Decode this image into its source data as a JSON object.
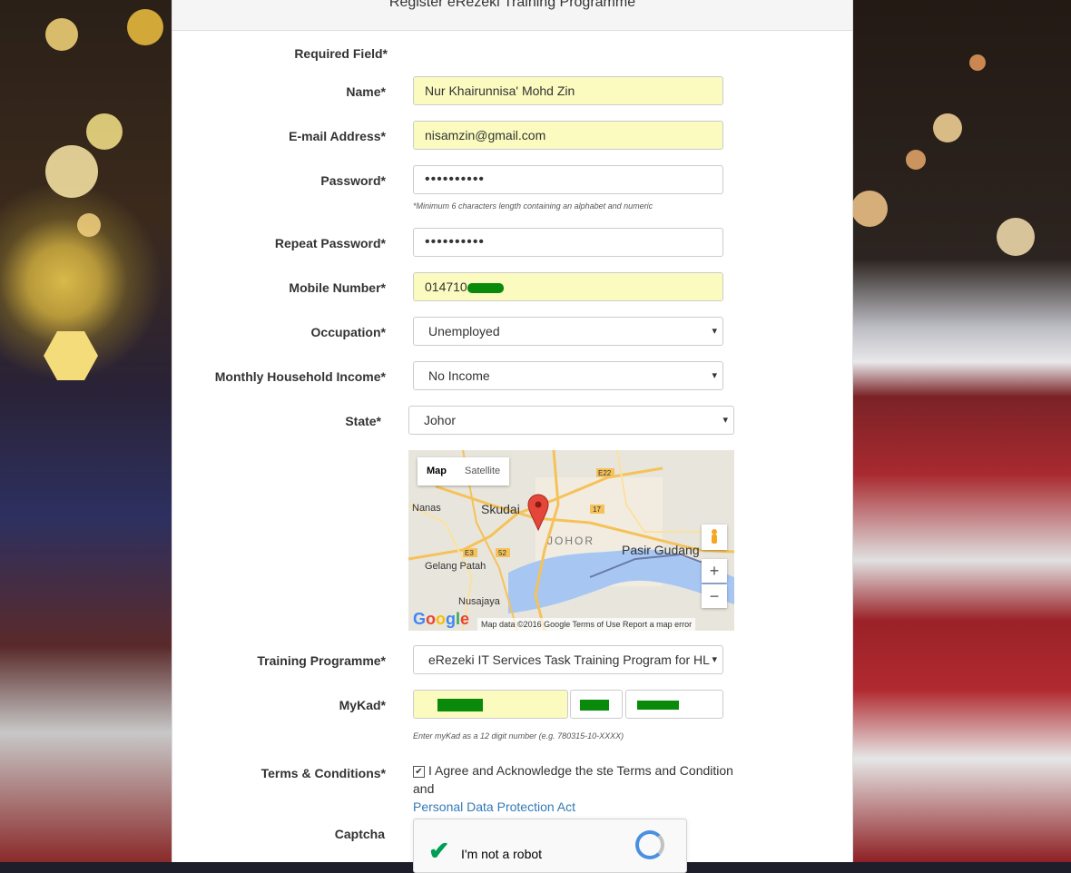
{
  "form": {
    "title": "Register eRezeki Training Programme",
    "required_note": "Required Field*",
    "name": {
      "label": "Name*",
      "value": "Nur Khairunnisa' Mohd Zin"
    },
    "email": {
      "label": "E-mail Address*",
      "value": "nisamzin@gmail.com"
    },
    "password": {
      "label": "Password*",
      "value": "••••••••••",
      "hint": "*Minimum 6 characters length containing an alphabet and numeric"
    },
    "repeat_password": {
      "label": "Repeat Password*",
      "value": "••••••••••"
    },
    "mobile": {
      "label": "Mobile Number*",
      "value": "014710"
    },
    "occupation": {
      "label": "Occupation*",
      "value": "Unemployed"
    },
    "income": {
      "label": "Monthly Household Income*",
      "value": "No Income"
    },
    "state": {
      "label": "State*",
      "value": "Johor"
    },
    "training": {
      "label": "Training Programme*",
      "value": "eRezeki IT Services Task Training Program for HL"
    },
    "mykad": {
      "label": "MyKad*",
      "hint": "Enter myKad as a 12 digit number (e.g. 780315-10-XXXX)"
    },
    "terms": {
      "label": "Terms & Conditions*",
      "text": "I Agree and Acknowledge the ste Terms and Condition and",
      "link": "Personal Data Protection Act",
      "checked": true
    },
    "captcha": {
      "label": "Captcha",
      "text": "I'm not a robot"
    }
  },
  "map": {
    "type_map": "Map",
    "type_satellite": "Satellite",
    "places": {
      "skudai": "Skudai",
      "johor": "JOHOR",
      "pasir_gudang": "Pasir Gudang",
      "nanas": "Nanas",
      "gelang_patah": "Gelang Patah",
      "nusajaya": "Nusajaya"
    },
    "roads": {
      "e22": "E22",
      "r17": "17",
      "e3": "E3",
      "r52": "52"
    },
    "zoom_in": "+",
    "zoom_out": "−",
    "attribution": "Map data ©2016 Google   Terms of Use   Report a map error",
    "logo": "Google"
  },
  "colors": {
    "filled_field": "#fbfbc0",
    "link": "#337ab7",
    "mask": "#0a8a0a"
  }
}
